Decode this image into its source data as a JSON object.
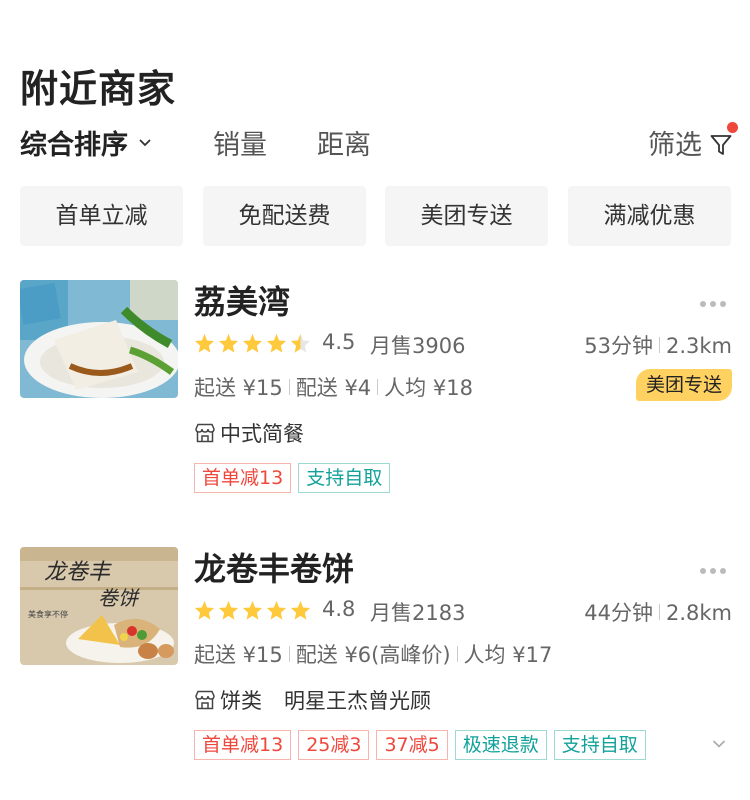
{
  "page": {
    "title": "附近商家"
  },
  "sort": {
    "items": [
      "综合排序",
      "销量",
      "距离"
    ],
    "filter_label": "筛选"
  },
  "chips": [
    "首单立减",
    "免配送费",
    "美团专送",
    "满减优惠"
  ],
  "stores": [
    {
      "name": "荔美湾",
      "rating": 4.5,
      "score": "4.5",
      "sales": "月售3906",
      "time": "53分钟",
      "distance": "2.3km",
      "min_order": "起送 ¥15",
      "delivery_fee": "配送 ¥4",
      "avg_price": "人均 ¥18",
      "delivery_badge": "美团专送",
      "category": "中式简餐",
      "extra": "",
      "tags": [
        {
          "text": "首单减13",
          "color": "red"
        },
        {
          "text": "支持自取",
          "color": "green"
        }
      ],
      "thumb_icon": "rice-noodle-roll-photo"
    },
    {
      "name": "龙卷丰卷饼",
      "rating": 4.8,
      "score": "4.8",
      "sales": "月售2183",
      "time": "44分钟",
      "distance": "2.8km",
      "min_order": "起送 ¥15",
      "delivery_fee": "配送 ¥6(高峰价)",
      "avg_price": "人均 ¥17",
      "delivery_badge": "",
      "category": "饼类",
      "extra": "明星王杰曾光顾",
      "tags": [
        {
          "text": "首单减13",
          "color": "red"
        },
        {
          "text": "25减3",
          "color": "red"
        },
        {
          "text": "37减5",
          "color": "red"
        },
        {
          "text": "极速退款",
          "color": "green"
        },
        {
          "text": "支持自取",
          "color": "green"
        }
      ],
      "thumb_icon": "wrap-photo"
    }
  ],
  "colors": {
    "star": "#ffc93c",
    "badge_yellow": "#ffd161",
    "tag_red": "#f0473b",
    "tag_green": "#13a29a",
    "filter_dot": "#f0473b"
  }
}
